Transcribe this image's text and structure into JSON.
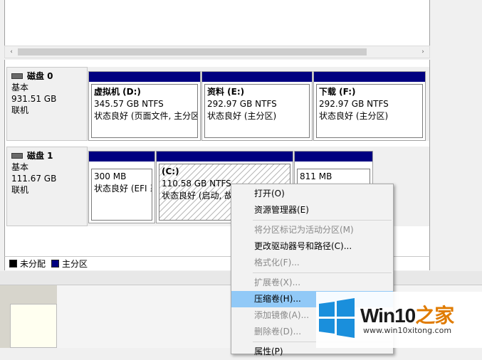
{
  "scrollbar": {
    "left_arrow": "‹",
    "right_arrow": "›"
  },
  "disks": [
    {
      "name": "磁盘 0",
      "type": "基本",
      "size": "931.51 GB",
      "status": "联机",
      "partitions": [
        {
          "name": "虚拟机 (D:)",
          "size": "345.57 GB NTFS",
          "status": "状态良好 (页面文件, 主分区"
        },
        {
          "name": "资料 (E:)",
          "size": "292.97 GB NTFS",
          "status": "状态良好 (主分区)"
        },
        {
          "name": "下载 (F:)",
          "size": "292.97 GB NTFS",
          "status": "状态良好 (主分区)"
        }
      ]
    },
    {
      "name": "磁盘 1",
      "type": "基本",
      "size": "111.67 GB",
      "status": "联机",
      "partitions": [
        {
          "name": "",
          "size": "300 MB",
          "status": "状态良好 (EFI 系"
        },
        {
          "name": "(C:)",
          "size": "110.58 GB NTFS",
          "status": "状态良好 (启动, 故"
        },
        {
          "name": "",
          "size": "811 MB",
          "status": ""
        }
      ]
    }
  ],
  "legend": {
    "unallocated": "未分配",
    "primary": "主分区"
  },
  "context_menu": [
    {
      "label": "打开(O)",
      "disabled": false
    },
    {
      "label": "资源管理器(E)",
      "disabled": false
    },
    {
      "separator": true
    },
    {
      "label": "将分区标记为活动分区(M)",
      "disabled": true
    },
    {
      "label": "更改驱动器号和路径(C)...",
      "disabled": false
    },
    {
      "label": "格式化(F)...",
      "disabled": true
    },
    {
      "separator": true
    },
    {
      "label": "扩展卷(X)...",
      "disabled": true
    },
    {
      "label": "压缩卷(H)...",
      "disabled": false,
      "highlighted": true
    },
    {
      "label": "添加镜像(A)...",
      "disabled": true
    },
    {
      "label": "删除卷(D)...",
      "disabled": true
    },
    {
      "separator": true
    },
    {
      "label": "属性(P)",
      "disabled": false
    }
  ],
  "watermark": {
    "brand": "Win10",
    "brand_zh": "之家",
    "url": "www.win10xitong.com"
  },
  "colors": {
    "partition_bar": "#000080",
    "highlight": "#91c9f7",
    "unallocated": "#000000",
    "primary": "#000080"
  }
}
